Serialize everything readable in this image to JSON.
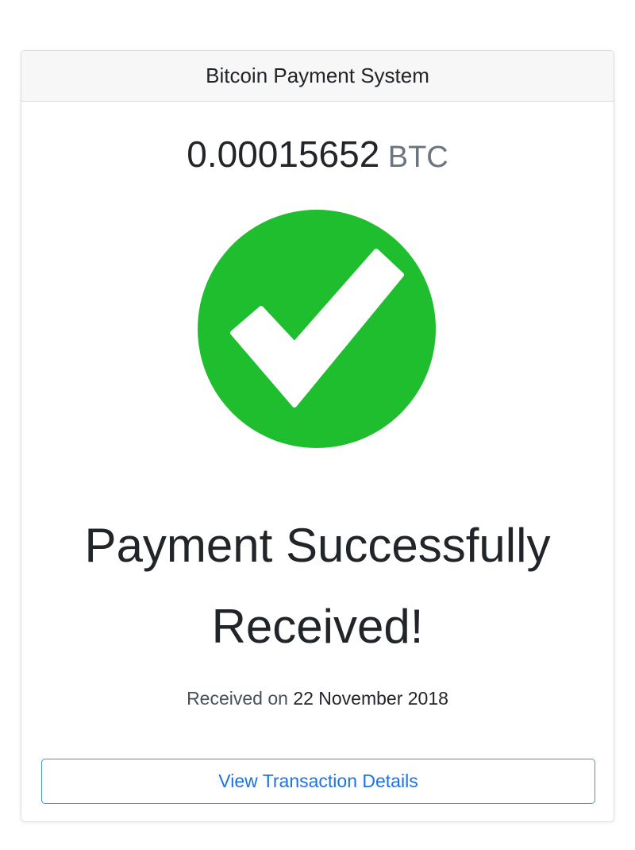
{
  "header": {
    "title": "Bitcoin Payment System"
  },
  "amount": {
    "value": "0.00015652",
    "unit": "BTC"
  },
  "status": {
    "icon": "check-circle-icon",
    "icon_color": "#1ebe2e",
    "title_line1": "Payment Successfully",
    "title_line2": "Received!"
  },
  "received": {
    "label": "Received on",
    "date": "22 November 2018"
  },
  "actions": {
    "details_label": "View Transaction Details",
    "accent_color": "#1a73e8"
  }
}
